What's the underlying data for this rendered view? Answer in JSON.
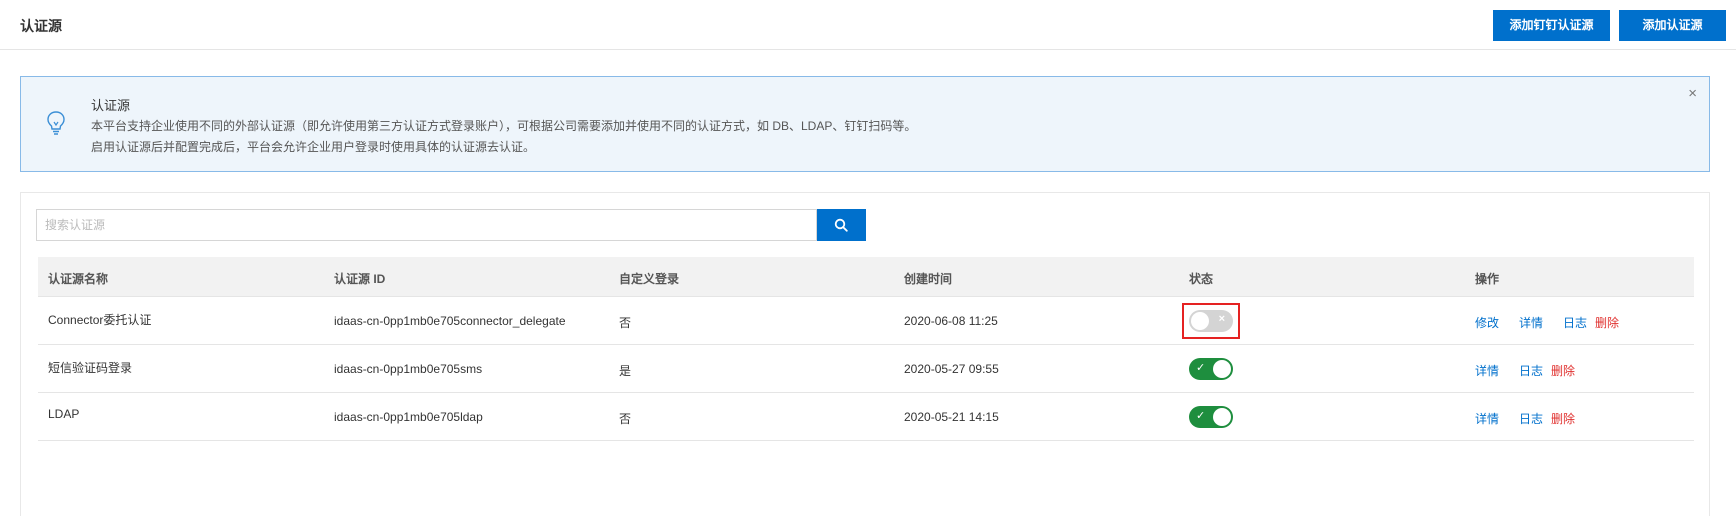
{
  "header": {
    "title": "认证源",
    "add_dingtalk_label": "添加钉钉认证源",
    "add_source_label": "添加认证源"
  },
  "notice": {
    "title": "认证源",
    "line1": "本平台支持企业使用不同的外部认证源（即允许使用第三方认证方式登录账户），可根据公司需要添加并使用不同的认证方式，如 DB、LDAP、钉钉扫码等。",
    "line2": "启用认证源后并配置完成后，平台会允许企业用户登录时使用具体的认证源去认证。",
    "close": "×",
    "icon": "lightbulb-icon"
  },
  "search": {
    "placeholder": "搜索认证源",
    "icon": "search-icon"
  },
  "table": {
    "columns": [
      "认证源名称",
      "认证源 ID",
      "自定义登录",
      "创建时间",
      "状态",
      "操作"
    ],
    "rows": [
      {
        "name": "Connector委托认证",
        "id": "idaas-cn-0pp1mb0e705connector_delegate",
        "custom_login": "否",
        "created": "2020-06-08 11:25",
        "enabled": false,
        "actions": [
          "修改",
          "详情",
          "日志",
          "删除"
        ]
      },
      {
        "name": "短信验证码登录",
        "id": "idaas-cn-0pp1mb0e705sms",
        "custom_login": "是",
        "created": "2020-05-27 09:55",
        "enabled": true,
        "actions": [
          "详情",
          "日志",
          "删除"
        ]
      },
      {
        "name": "LDAP",
        "id": "idaas-cn-0pp1mb0e705ldap",
        "custom_login": "否",
        "created": "2020-05-21 14:15",
        "enabled": true,
        "actions": [
          "详情",
          "日志",
          "删除"
        ]
      }
    ],
    "switch_on_mark": "✓",
    "switch_off_mark": "×"
  },
  "colors": {
    "primary": "#0070cc",
    "switch_on": "#1e8e3e",
    "switch_off": "#d4d4d4",
    "danger": "#e0302e",
    "highlight": "#e52222"
  }
}
